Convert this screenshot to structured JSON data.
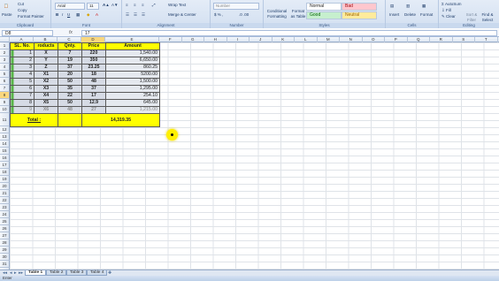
{
  "ribbon": {
    "clipboard": {
      "paste": "Paste",
      "cut": "Cut",
      "copy": "Copy",
      "painter": "Format Painter",
      "label": "Clipboard"
    },
    "font": {
      "name": "Arial",
      "size": "11",
      "label": "Font"
    },
    "alignment": {
      "wrap": "Wrap Text",
      "merge": "Merge & Center",
      "label": "Alignment"
    },
    "number": {
      "format": "Number",
      "label": "Number"
    },
    "styles": {
      "conditional": "Conditional Formatting",
      "format_table": "Format as Table",
      "normal": "Normal",
      "bad": "Bad",
      "good": "Good",
      "neutral": "Neutral",
      "label": "Styles"
    },
    "cells": {
      "insert": "Insert",
      "delete": "Delete",
      "format": "Format",
      "label": "Cells"
    },
    "editing": {
      "autosum": "AutoSum",
      "fill": "Fill",
      "clear": "Clear",
      "sort": "Sort & Filter",
      "find": "Find & Select",
      "label": "Editing"
    }
  },
  "formula_bar": {
    "name_box": "D8",
    "fx": "fx",
    "value": "17"
  },
  "columns": [
    "A",
    "B",
    "C",
    "D",
    "E",
    "F",
    "G",
    "H",
    "I",
    "J",
    "K",
    "L",
    "M",
    "N",
    "O",
    "P",
    "Q",
    "R",
    "S",
    "T",
    "U"
  ],
  "selected_column": "D",
  "rows": [
    "1",
    "2",
    "3",
    "4",
    "5",
    "6",
    "7",
    "8",
    "9",
    "10",
    "11",
    "12",
    "13",
    "14",
    "15",
    "16",
    "17",
    "18",
    "19",
    "20",
    "21",
    "22",
    "23",
    "24",
    "25",
    "26",
    "27",
    "28",
    "29",
    "30",
    "31",
    "32",
    "33"
  ],
  "selected_row": "8",
  "table": {
    "headers": [
      "SL. No.",
      "roducts",
      "Qnty.",
      "Price",
      "Amount"
    ],
    "rows": [
      [
        "1",
        "X",
        "7",
        "220",
        "1,540.00"
      ],
      [
        "2",
        "Y",
        "19",
        "350",
        "6,650.00"
      ],
      [
        "3",
        "Z",
        "37",
        "23.25",
        "860.25"
      ],
      [
        "4",
        "X1",
        "20",
        "18",
        "5200.00"
      ],
      [
        "5",
        "X2",
        "50",
        "48",
        "1,500.00"
      ],
      [
        "6",
        "X3",
        "35",
        "37",
        "1,295.00"
      ],
      [
        "7",
        "X4",
        "22",
        "17",
        "254.10"
      ],
      [
        "8",
        "X5",
        "50",
        "12.9",
        "645.00"
      ],
      [
        "9",
        "X6",
        "48",
        "27",
        "1,215.00"
      ]
    ],
    "total_label": "Total :",
    "total_value": "14,319.35"
  },
  "sheet_tabs": [
    "Table 1",
    "Table 2",
    "Table 3",
    "Table 4"
  ],
  "active_tab": "Table 1",
  "status": "Enter"
}
